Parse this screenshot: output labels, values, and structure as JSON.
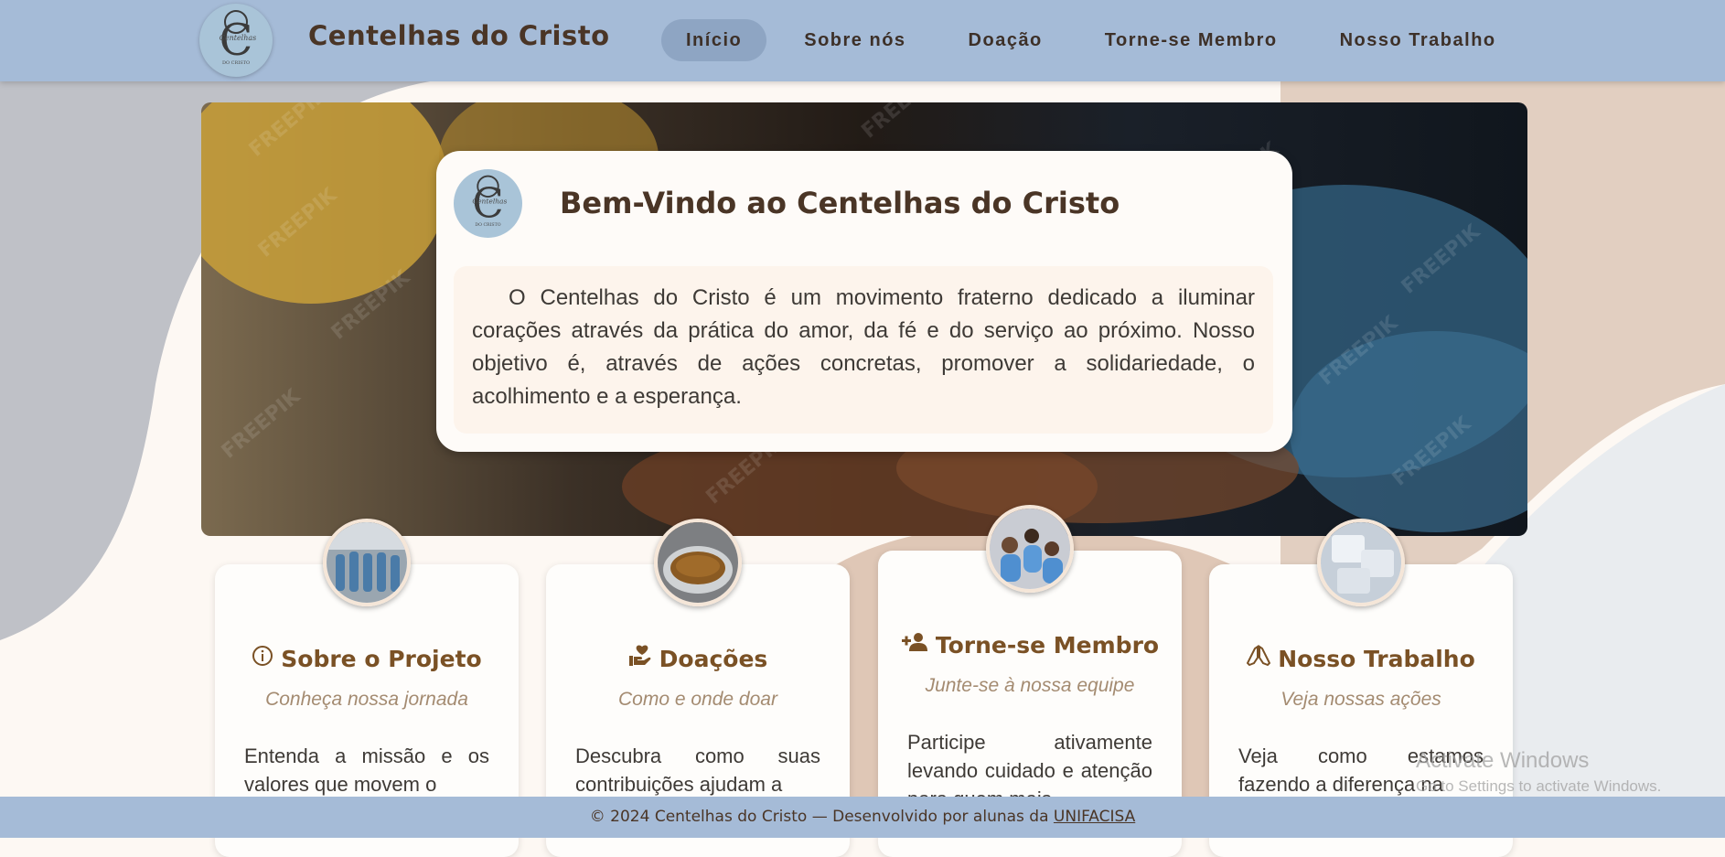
{
  "header": {
    "brand": "Centelhas do Cristo",
    "logo_text": "Centelhas",
    "logo_sub": "DO CRISTO",
    "nav": [
      {
        "label": "Início",
        "active": true
      },
      {
        "label": "Sobre nós",
        "active": false
      },
      {
        "label": "Doação",
        "active": false
      },
      {
        "label": "Torne-se Membro",
        "active": false
      },
      {
        "label": "Nosso Trabalho",
        "active": false
      }
    ]
  },
  "hero": {
    "title": "Bem-Vindo ao Centelhas do Cristo",
    "text": "O Centelhas do Cristo é um movimento fraterno dedicado a iluminar corações através da prática do amor, da fé e do serviço ao próximo. Nosso objetivo é, através de ações concretas, promover a solidariedade, o acolhimento e a esperança.",
    "watermark_text": "FREEPIK"
  },
  "cards": [
    {
      "icon": "info-icon",
      "title": "Sobre o Projeto",
      "subtitle": "Conheça nossa jornada",
      "body": "Entenda a missão e os valores que movem o"
    },
    {
      "icon": "hand-heart-icon",
      "title": "Doações",
      "subtitle": "Como e onde doar",
      "body": "Descubra como suas contribuições ajudam a"
    },
    {
      "icon": "user-plus-icon",
      "title": "Torne-se Membro",
      "subtitle": "Junte-se à nossa equipe",
      "body": "Participe ativamente levando cuidado e atenção para quem mais"
    },
    {
      "icon": "praying-hands-icon",
      "title": "Nosso Trabalho",
      "subtitle": "Veja nossas ações",
      "body": "Veja como estamos fazendo a diferença na"
    }
  ],
  "footer": {
    "text": "© 2024 Centelhas do Cristo — Desenvolvido por alunas da",
    "link": "UNIFACISA"
  },
  "os_watermark": {
    "line1": "Activate Windows",
    "line2": "Go to Settings to activate Windows."
  },
  "colors": {
    "header_bg": "#a5bbd7",
    "nav_active_bg": "#8ea5c3",
    "brand_text": "#4a3526",
    "card_title": "#7a5125",
    "card_subtitle": "#a48b71",
    "page_bg": "#fdf8f3"
  }
}
